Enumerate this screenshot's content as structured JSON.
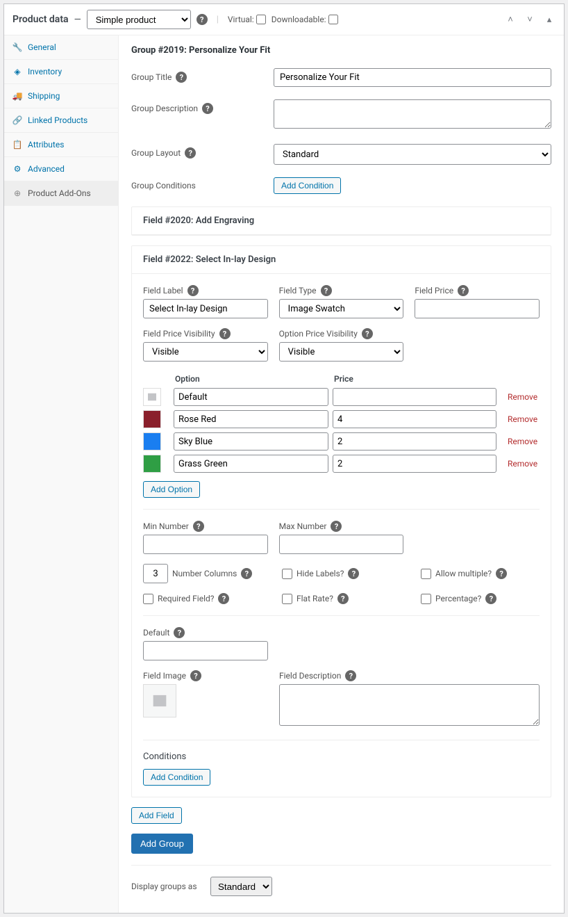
{
  "header": {
    "title": "Product data",
    "product_type_selected": "Simple product",
    "virtual_label": "Virtual:",
    "virtual_checked": false,
    "downloadable_label": "Downloadable:",
    "downloadable_checked": false
  },
  "sidebar": {
    "items": [
      {
        "label": "General"
      },
      {
        "label": "Inventory"
      },
      {
        "label": "Shipping"
      },
      {
        "label": "Linked Products"
      },
      {
        "label": "Attributes"
      },
      {
        "label": "Advanced"
      },
      {
        "label": "Product Add-Ons"
      }
    ]
  },
  "group": {
    "heading": "Group #2019: Personalize Your Fit",
    "labels": {
      "title": "Group Title",
      "description": "Group Description",
      "layout": "Group Layout",
      "conditions": "Group Conditions",
      "add_condition": "Add Condition"
    },
    "values": {
      "title": "Personalize Your Fit",
      "description": "",
      "layout": "Standard"
    }
  },
  "field_collapsed": {
    "heading": "Field #2020: Add Engraving"
  },
  "field": {
    "heading": "Field #2022: Select In-lay Design",
    "labels": {
      "field_label": "Field Label",
      "field_type": "Field Type",
      "field_price": "Field Price",
      "field_price_vis": "Field Price Visibility",
      "option_price_vis": "Option Price Visibility",
      "col_option": "Option",
      "col_price": "Price",
      "remove": "Remove",
      "add_option": "Add Option",
      "min_number": "Min Number",
      "max_number": "Max Number",
      "number_columns": "Number Columns",
      "hide_labels": "Hide Labels?",
      "allow_multiple": "Allow multiple?",
      "required": "Required Field?",
      "flat_rate": "Flat Rate?",
      "percentage": "Percentage?",
      "default": "Default",
      "field_image": "Field Image",
      "field_description": "Field Description",
      "conditions": "Conditions",
      "add_condition": "Add Condition",
      "add_field": "Add Field",
      "add_group": "Add Group"
    },
    "values": {
      "field_label": "Select In-lay Design",
      "field_type": "Image Swatch",
      "field_price": "",
      "field_price_vis": "Visible",
      "option_price_vis": "Visible",
      "min_number": "",
      "max_number": "",
      "number_columns": "3",
      "hide_labels": false,
      "allow_multiple": false,
      "required": false,
      "flat_rate": false,
      "percentage": false,
      "default": "",
      "field_description": ""
    },
    "options": [
      {
        "name": "Default",
        "price": "",
        "color": "none"
      },
      {
        "name": "Rose Red",
        "price": "4",
        "color": "#8a1f2b"
      },
      {
        "name": "Sky Blue",
        "price": "2",
        "color": "#1a7ef0"
      },
      {
        "name": "Grass Green",
        "price": "2",
        "color": "#2f9e44"
      }
    ]
  },
  "footer": {
    "display_groups_label": "Display groups as",
    "display_groups_value": "Standard"
  }
}
